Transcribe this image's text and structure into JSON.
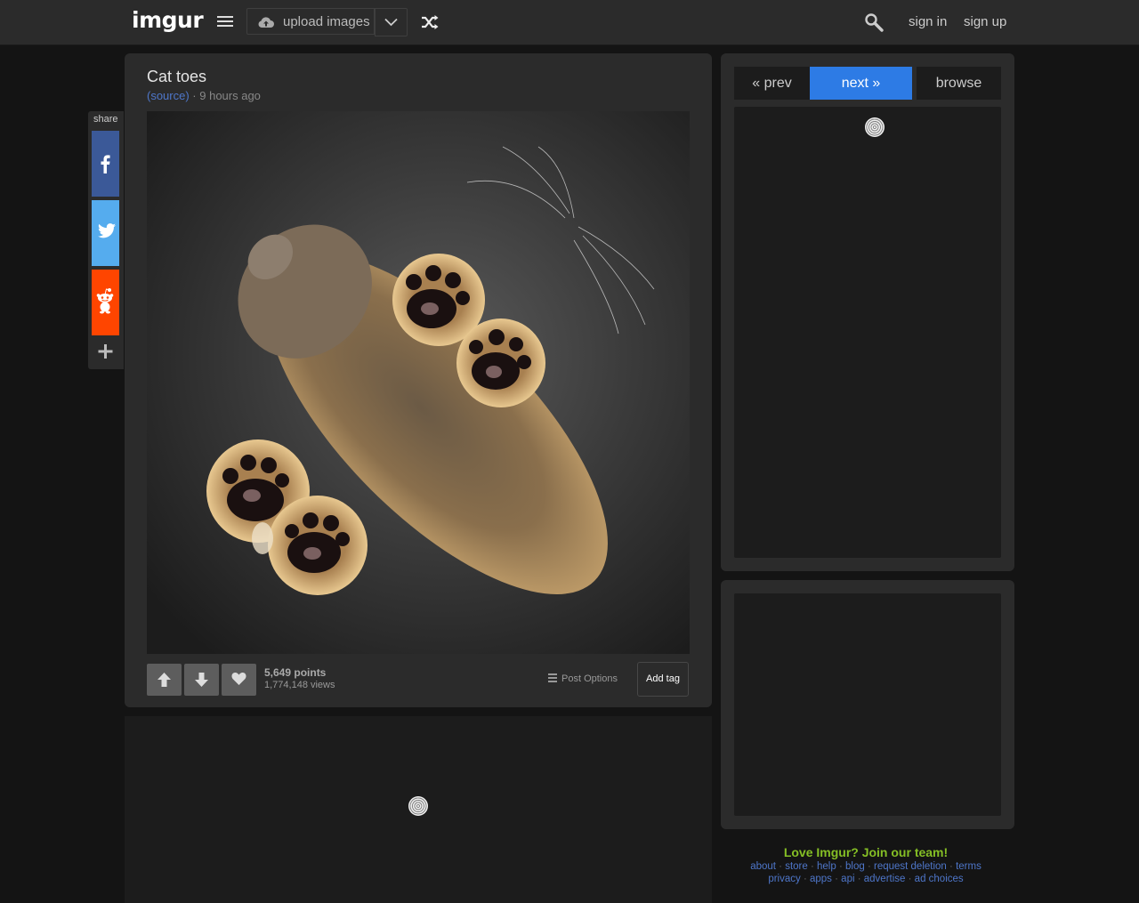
{
  "header": {
    "logo": "imgur",
    "upload_label": "upload images",
    "sign_in": "sign in",
    "sign_up": "sign up"
  },
  "post": {
    "title": "Cat toes",
    "source_label": "(source)",
    "separator": " · ",
    "time_ago": "9 hours ago",
    "image_alt": "cat paws photographed from below through glass",
    "points": "5,649 points",
    "views": "1,774,148 views",
    "post_options": "Post Options",
    "add_tag": "Add tag"
  },
  "share": {
    "label": "share",
    "items": [
      {
        "name": "facebook",
        "color": "#3b5998"
      },
      {
        "name": "twitter",
        "color": "#55acee"
      },
      {
        "name": "reddit",
        "color": "#ff4500"
      }
    ]
  },
  "sidebar": {
    "prev": "« prev",
    "next": "next »",
    "browse": "browse"
  },
  "footer": {
    "title": "Love Imgur? Join our team!",
    "row1": [
      "about",
      "store",
      "help",
      "blog",
      "request deletion",
      "terms"
    ],
    "row2": [
      "privacy",
      "apps",
      "api",
      "advertise",
      "ad choices"
    ]
  },
  "colors": {
    "accent_blue": "#2d7be5",
    "link_blue": "#4e76c9",
    "footer_green": "#85bf25",
    "panel": "#2b2b2b",
    "background": "#141414"
  }
}
